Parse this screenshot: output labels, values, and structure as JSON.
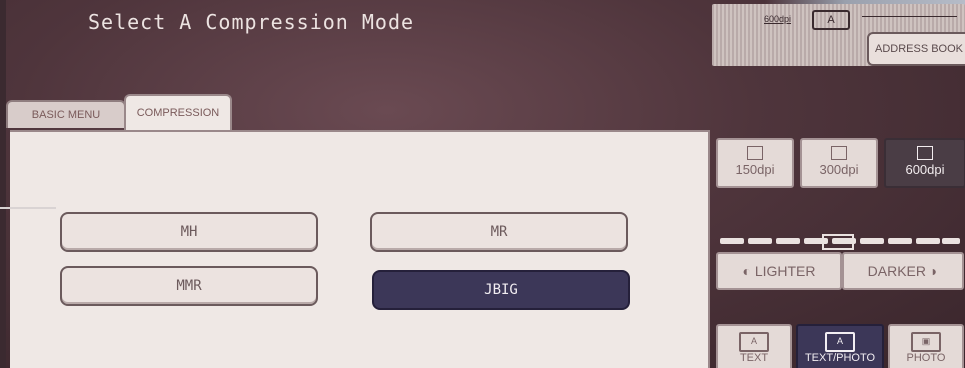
{
  "header": {
    "title": "Select A Compression Mode"
  },
  "status": {
    "dpi": "600dpi",
    "mode_icon": "A",
    "address_book_label": "ADDRESS BOOK"
  },
  "tabs": [
    {
      "label": "BASIC MENU",
      "active": false
    },
    {
      "label": "COMPRESSION",
      "active": true
    }
  ],
  "compression_modes": [
    {
      "label": "MH",
      "selected": false
    },
    {
      "label": "MR",
      "selected": false
    },
    {
      "label": "MMR",
      "selected": false
    },
    {
      "label": "JBIG",
      "selected": true
    }
  ],
  "resolution": [
    {
      "label": "150dpi",
      "selected": false
    },
    {
      "label": "300dpi",
      "selected": false
    },
    {
      "label": "600dpi",
      "selected": true
    }
  ],
  "density": {
    "lighter_label": "LIGHTER",
    "darker_label": "DARKER",
    "level": 5,
    "steps": 9
  },
  "original_type": [
    {
      "label": "TEXT",
      "icon": "A",
      "selected": false
    },
    {
      "label": "TEXT/PHOTO",
      "icon": "A",
      "selected": true
    },
    {
      "label": "PHOTO",
      "icon": "",
      "selected": false
    }
  ],
  "colors": {
    "selected": "#3c3758",
    "background": "#4f353c",
    "button": "#ece3e0"
  }
}
